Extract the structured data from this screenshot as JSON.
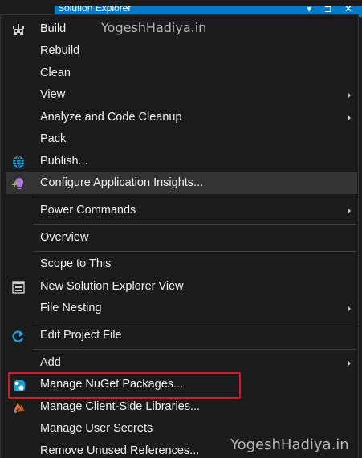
{
  "window": {
    "title": "Solution Explorer",
    "controls": "▾ ⊐ ✕"
  },
  "watermark": "YogeshHadiya.in",
  "menu": {
    "items": [
      {
        "label": "Build"
      },
      {
        "label": "Rebuild"
      },
      {
        "label": "Clean"
      },
      {
        "label": "View"
      },
      {
        "label": "Analyze and Code Cleanup"
      },
      {
        "label": "Pack"
      },
      {
        "label": "Publish..."
      },
      {
        "label": "Configure Application Insights..."
      },
      {
        "label": "Power Commands"
      },
      {
        "label": "Overview"
      },
      {
        "label": "Scope to This"
      },
      {
        "label": "New Solution Explorer View"
      },
      {
        "label": "File Nesting"
      },
      {
        "label": "Edit Project File"
      },
      {
        "label": "Add"
      },
      {
        "label": "Manage NuGet Packages..."
      },
      {
        "label": "Manage Client-Side Libraries..."
      },
      {
        "label": "Manage User Secrets"
      },
      {
        "label": "Remove Unused References..."
      }
    ]
  },
  "colors": {
    "menu_background": "#1b1b1c",
    "highlight": "#333334",
    "text": "#f1f1f1",
    "accent_titlebar": "#007acc",
    "callout_border": "#e81123"
  }
}
